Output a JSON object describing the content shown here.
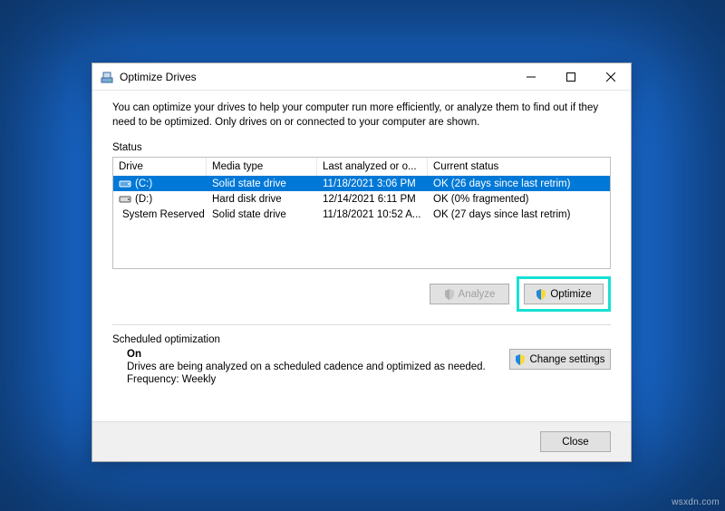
{
  "window": {
    "title": "Optimize Drives",
    "description": "You can optimize your drives to help your computer run more efficiently, or analyze them to find out if they need to be optimized. Only drives on or connected to your computer are shown."
  },
  "status": {
    "label": "Status",
    "columns": {
      "drive": "Drive",
      "media": "Media type",
      "last": "Last analyzed or o...",
      "status": "Current status"
    },
    "rows": [
      {
        "name": "(C:)",
        "media": "Solid state drive",
        "last": "11/18/2021 3:06 PM",
        "status": "OK (26 days since last retrim)",
        "selected": true,
        "icon": "ssd"
      },
      {
        "name": "(D:)",
        "media": "Hard disk drive",
        "last": "12/14/2021 6:11 PM",
        "status": "OK (0% fragmented)",
        "selected": false,
        "icon": "hdd"
      },
      {
        "name": "System Reserved",
        "media": "Solid state drive",
        "last": "11/18/2021 10:52 A...",
        "status": "OK (27 days since last retrim)",
        "selected": false,
        "icon": "hdd"
      }
    ]
  },
  "buttons": {
    "analyze": "Analyze",
    "optimize": "Optimize",
    "change_settings": "Change settings",
    "close": "Close"
  },
  "scheduled": {
    "label": "Scheduled optimization",
    "state": "On",
    "desc": "Drives are being analyzed on a scheduled cadence and optimized as needed.",
    "freq": "Frequency: Weekly"
  },
  "watermark": "wsxdn.com"
}
